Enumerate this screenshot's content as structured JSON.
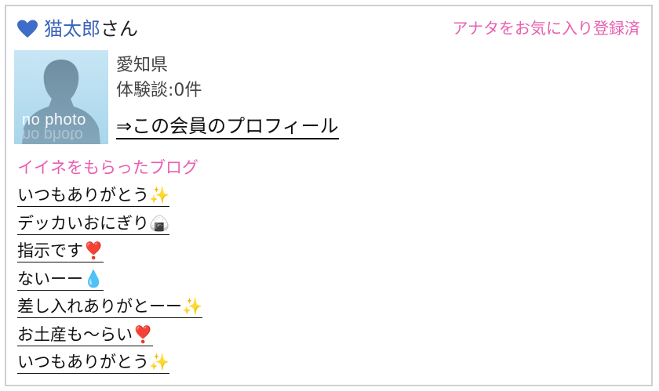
{
  "header": {
    "name": "猫太郎",
    "suffix": "さん",
    "favorite_status": "アナタをお気に入り登録済",
    "heart_icon": "heart-icon"
  },
  "profile": {
    "avatar_text": "no photo",
    "prefecture": "愛知県",
    "experience": "体験談:0件",
    "profile_link": "⇒この会員のプロフィール"
  },
  "blogs": {
    "title": "イイネをもらったブログ",
    "items": [
      {
        "label": "いつもありがとう✨"
      },
      {
        "label": "デッカいおにぎり🍙"
      },
      {
        "label": "指示です❣️"
      },
      {
        "label": "ないーー💧"
      },
      {
        "label": "差し入れありがとーー✨"
      },
      {
        "label": "お土産も〜らい❣️"
      },
      {
        "label": "いつもありがとう✨"
      }
    ]
  },
  "colors": {
    "accent_pink": "#e85fb0",
    "name_blue": "#3a63b8",
    "heart_blue": "#3d6cc9",
    "border": "#cfcfcf"
  }
}
